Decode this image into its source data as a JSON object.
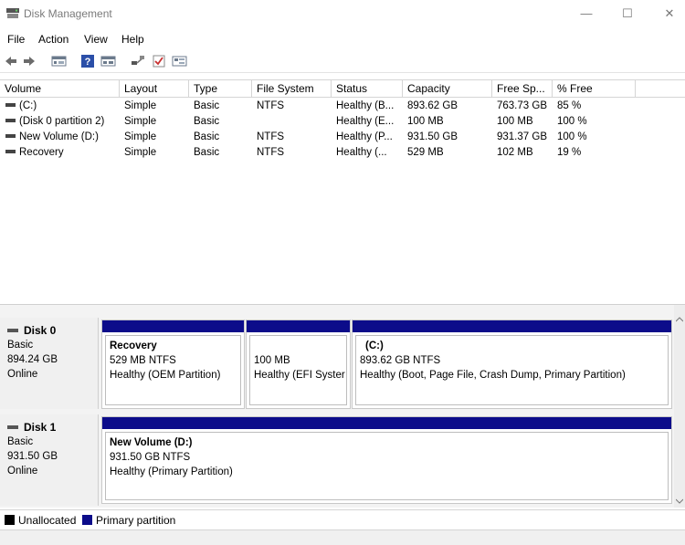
{
  "window": {
    "title": "Disk Management",
    "controls": {
      "minimize": "—",
      "maximize": "☐",
      "close": "✕"
    }
  },
  "menu": [
    "File",
    "Action",
    "View",
    "Help"
  ],
  "toolbar": [
    "back-icon",
    "forward-icon",
    "list-view-icon",
    "help-icon",
    "properties-icon",
    "connect-icon",
    "check-icon",
    "settings-icon"
  ],
  "table": {
    "columns": [
      "Volume",
      "Layout",
      "Type",
      "File System",
      "Status",
      "Capacity",
      "Free Sp...",
      "% Free"
    ],
    "rows": [
      {
        "volume": "(C:)",
        "layout": "Simple",
        "type": "Basic",
        "fs": "NTFS",
        "status": "Healthy (B...",
        "capacity": "893.62 GB",
        "free": "763.73 GB",
        "pct": "85 %"
      },
      {
        "volume": "(Disk 0 partition 2)",
        "layout": "Simple",
        "type": "Basic",
        "fs": "",
        "status": "Healthy (E...",
        "capacity": "100 MB",
        "free": "100 MB",
        "pct": "100 %"
      },
      {
        "volume": "New Volume (D:)",
        "layout": "Simple",
        "type": "Basic",
        "fs": "NTFS",
        "status": "Healthy (P...",
        "capacity": "931.50 GB",
        "free": "931.37 GB",
        "pct": "100 %"
      },
      {
        "volume": "Recovery",
        "layout": "Simple",
        "type": "Basic",
        "fs": "NTFS",
        "status": "Healthy (...",
        "capacity": "529 MB",
        "free": "102 MB",
        "pct": "19 %"
      }
    ]
  },
  "disks": [
    {
      "name": "Disk 0",
      "kind": "Basic",
      "size": "894.24 GB",
      "state": "Online",
      "partitions": [
        {
          "name": "Recovery",
          "size": "529 MB NTFS",
          "status": "Healthy (OEM Partition)"
        },
        {
          "name": "",
          "size": "100 MB",
          "status": "Healthy (EFI Syster"
        },
        {
          "name": "(C:)",
          "size": "893.62 GB NTFS",
          "status": "Healthy (Boot, Page File, Crash Dump, Primary Partition)"
        }
      ]
    },
    {
      "name": "Disk 1",
      "kind": "Basic",
      "size": "931.50 GB",
      "state": "Online",
      "partitions": [
        {
          "name": "New Volume  (D:)",
          "size": "931.50 GB NTFS",
          "status": "Healthy (Primary Partition)"
        }
      ]
    }
  ],
  "legend": [
    {
      "label": "Unallocated",
      "color": "#000000"
    },
    {
      "label": "Primary partition",
      "color": "#0c0c8a"
    }
  ]
}
